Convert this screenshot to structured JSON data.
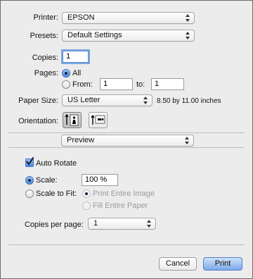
{
  "printer": {
    "label": "Printer:",
    "value": "EPSON"
  },
  "presets": {
    "label": "Presets:",
    "value": "Default Settings"
  },
  "copies": {
    "label": "Copies:",
    "value": "1"
  },
  "pages": {
    "label": "Pages:",
    "all_label": "All",
    "from_label": "From:",
    "from_value": "1",
    "to_label": "to:",
    "to_value": "1"
  },
  "paper_size": {
    "label": "Paper Size:",
    "value": "US Letter",
    "dimensions": "8.50 by 11.00 inches"
  },
  "orientation": {
    "label": "Orientation:",
    "selected": "portrait"
  },
  "section_popup": {
    "value": "Preview"
  },
  "preview": {
    "auto_rotate_label": "Auto Rotate",
    "scale_label": "Scale:",
    "scale_value": "100 %",
    "scale_to_fit_label": "Scale to Fit:",
    "print_entire_image_label": "Print Entire Image",
    "fill_entire_paper_label": "Fill Entire Paper",
    "copies_per_page_label": "Copies per page:",
    "copies_per_page_value": "1"
  },
  "buttons": {
    "cancel": "Cancel",
    "print": "Print"
  },
  "colors": {
    "accent": "#4d8ae0",
    "default_button": "#7ba9e8"
  }
}
